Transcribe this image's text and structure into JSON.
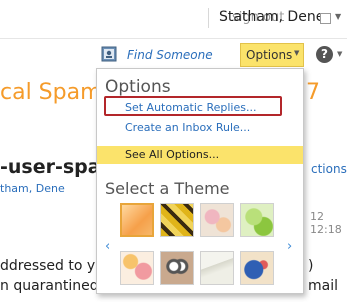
{
  "header": {
    "sign_out": "sign out",
    "user_name": "Statham, Dene"
  },
  "toolbar": {
    "find_someone": "Find Someone",
    "options_label": "Options",
    "help_glyph": "?"
  },
  "background": {
    "title_left": "cal Spam",
    "title_right": "7",
    "message_heading": "-user-spam",
    "actions_fragment": "ctions",
    "sender_fragment": "tham, Dene",
    "date_fragment": "12 12:18",
    "body_line1": "ddressed to y",
    "body_line1_right": ")",
    "body_line2": "n quarantined",
    "body_line2_right": "mail"
  },
  "options_menu": {
    "title": "Options",
    "items": [
      {
        "label": "Set Automatic Replies...",
        "highlighted": true
      },
      {
        "label": "Create an Inbox Rule..."
      }
    ],
    "see_all": "See All Options...",
    "theme_title": "Select a Theme",
    "themes": [
      "orange",
      "bees",
      "flowers",
      "green-leaves",
      "flowers-2",
      "robot",
      "paper",
      "bird"
    ],
    "selected_theme": "orange"
  },
  "colors": {
    "accent_yellow": "#fbe36b",
    "link_blue": "#2a6ebb",
    "title_orange": "#f59b2a",
    "callout_red": "#b3262a"
  }
}
